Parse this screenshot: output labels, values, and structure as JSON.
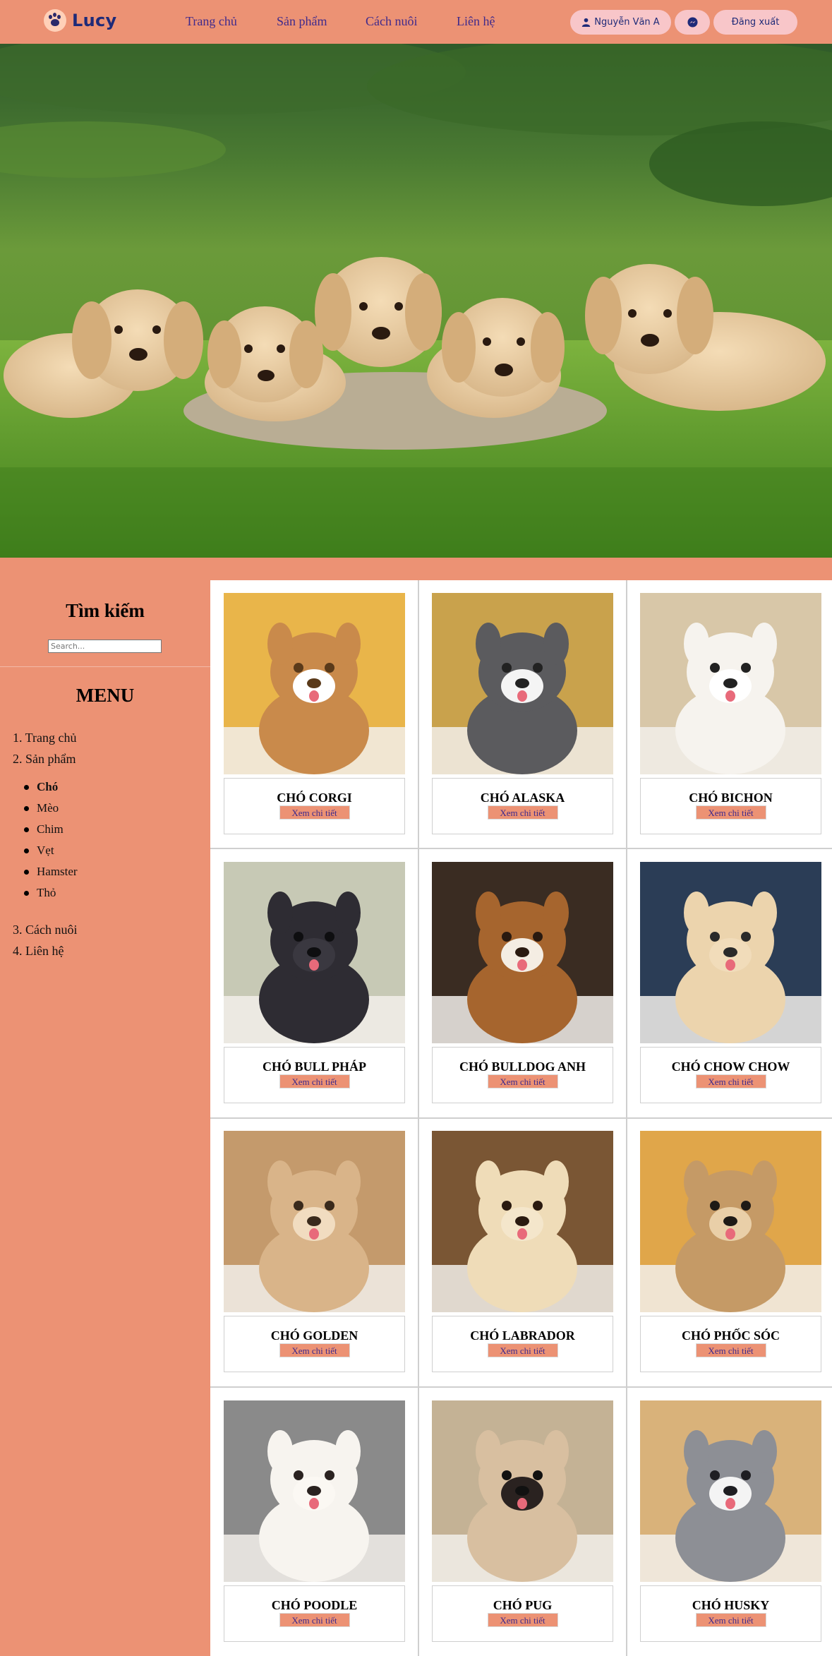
{
  "brand": {
    "name": "Lucy",
    "accent": "#ec9274"
  },
  "nav": [
    {
      "label": "Trang chủ"
    },
    {
      "label": "Sản phẩm"
    },
    {
      "label": "Cách nuôi"
    },
    {
      "label": "Liên hệ"
    }
  ],
  "account": {
    "user_name": "Nguyễn Văn A",
    "messenger_icon": "messenger-icon",
    "logout_label": "Đăng xuất"
  },
  "hero": {
    "image": "puppies-on-grass"
  },
  "sidebar": {
    "search_title": "Tìm kiếm",
    "search_placeholder": "Search...",
    "menu_title": "MENU",
    "menu_top": [
      {
        "label": "1. Trang chủ"
      },
      {
        "label": "2. Sản phẩm"
      }
    ],
    "sub_items": [
      {
        "label": "Chó",
        "active": true
      },
      {
        "label": "Mèo"
      },
      {
        "label": "Chim"
      },
      {
        "label": "Vẹt"
      },
      {
        "label": "Hamster"
      },
      {
        "label": "Thỏ"
      }
    ],
    "menu_bottom": [
      {
        "label": "3. Cách nuôi"
      },
      {
        "label": "4. Liên hệ"
      }
    ]
  },
  "products": [
    {
      "name": "CHÓ CORGI",
      "button": "Xem chi tiết",
      "fur": "#c98a4b",
      "bg": "#e9b54a",
      "face": "#ffffff",
      "dark": "#5a3a1a"
    },
    {
      "name": "CHÓ ALASKA",
      "button": "Xem chi tiết",
      "fur": "#5b5b5e",
      "bg": "#c9a24c",
      "face": "#f4f4f4",
      "dark": "#222222"
    },
    {
      "name": "CHÓ BICHON",
      "button": "Xem chi tiết",
      "fur": "#f6f3ee",
      "bg": "#d8c7a8",
      "face": "#ffffff",
      "dark": "#222222"
    },
    {
      "name": "CHÓ BULL PHÁP",
      "button": "Xem chi tiết",
      "fur": "#2e2c33",
      "bg": "#c7c9b5",
      "face": "#3a3840",
      "dark": "#0e0e10"
    },
    {
      "name": "CHÓ BULLDOG ANH",
      "button": "Xem chi tiết",
      "fur": "#a6652e",
      "bg": "#3a2c22",
      "face": "#f4ede3",
      "dark": "#2a1a10"
    },
    {
      "name": "CHÓ CHOW CHOW",
      "button": "Xem chi tiết",
      "fur": "#ecd4ad",
      "bg": "#2b3d56",
      "face": "#f1dcba",
      "dark": "#2a2a2a"
    },
    {
      "name": "CHÓ GOLDEN",
      "button": "Xem chi tiết",
      "fur": "#d9b489",
      "bg": "#c49a6c",
      "face": "#f1dcc0",
      "dark": "#3a2a1c"
    },
    {
      "name": "CHÓ LABRADOR",
      "button": "Xem chi tiết",
      "fur": "#efdcb8",
      "bg": "#7a5634",
      "face": "#f4e6cb",
      "dark": "#2a1a10"
    },
    {
      "name": "CHÓ PHỐC SÓC",
      "button": "Xem chi tiết",
      "fur": "#c59a66",
      "bg": "#e0a64a",
      "face": "#e9cfa8",
      "dark": "#1e1a16"
    },
    {
      "name": "CHÓ POODLE",
      "button": "Xem chi tiết",
      "fur": "#f7f4ef",
      "bg": "#8a8a8a",
      "face": "#fbf8f3",
      "dark": "#2a2220"
    },
    {
      "name": "CHÓ PUG",
      "button": "Xem chi tiết",
      "fur": "#d8bfa0",
      "bg": "#c4b295",
      "face": "#2a2220",
      "dark": "#111111"
    },
    {
      "name": "CHÓ HUSKY",
      "button": "Xem chi tiết",
      "fur": "#8d8f95",
      "bg": "#d9b27a",
      "face": "#f4f4f4",
      "dark": "#1e1e22"
    }
  ]
}
